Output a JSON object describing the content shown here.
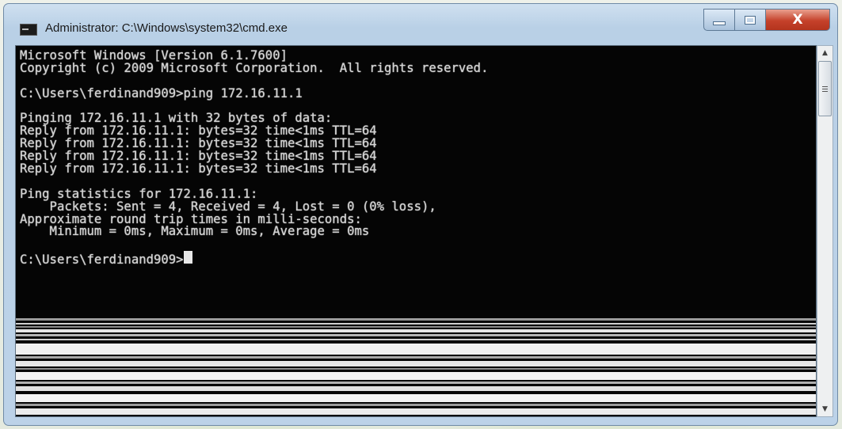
{
  "window": {
    "title": "Administrator: C:\\Windows\\system32\\cmd.exe",
    "icon": "cmd-icon",
    "controls": {
      "minimize_icon": "minimize-icon",
      "maximize_icon": "maximize-icon",
      "close_label": "X"
    }
  },
  "console": {
    "lines": [
      "Microsoft Windows [Version 6.1.7600]",
      "Copyright (c) 2009 Microsoft Corporation.  All rights reserved.",
      "",
      "C:\\Users\\ferdinand909>ping 172.16.11.1",
      "",
      "Pinging 172.16.11.1 with 32 bytes of data:",
      "Reply from 172.16.11.1: bytes=32 time<1ms TTL=64",
      "Reply from 172.16.11.1: bytes=32 time<1ms TTL=64",
      "Reply from 172.16.11.1: bytes=32 time<1ms TTL=64",
      "Reply from 172.16.11.1: bytes=32 time<1ms TTL=64",
      "",
      "Ping statistics for 172.16.11.1:",
      "    Packets: Sent = 4, Received = 4, Lost = 0 (0% loss),",
      "Approximate round trip times in milli-seconds:",
      "    Minimum = 0ms, Maximum = 0ms, Average = 0ms",
      "",
      "C:\\Users\\ferdinand909>"
    ],
    "text_color": "#d2d2d2",
    "background": "#050505"
  },
  "scrollbar": {
    "up_icon": "scroll-up-arrow-icon",
    "down_icon": "scroll-down-arrow-icon"
  },
  "colors": {
    "titlebar": "#bcd2e8",
    "close_button": "#c5412a"
  }
}
